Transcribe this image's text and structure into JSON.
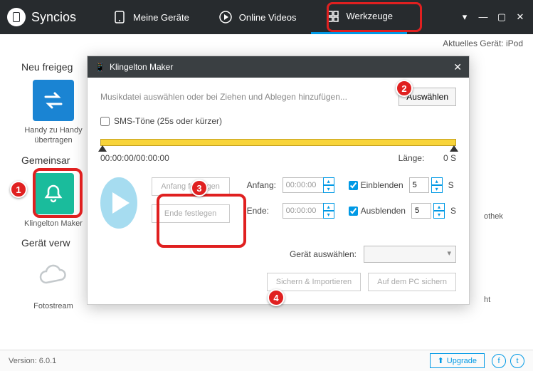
{
  "app": {
    "name": "Syncios"
  },
  "nav": {
    "devices": "Meine Geräte",
    "videos": "Online Videos",
    "tools": "Werkzeuge"
  },
  "status": {
    "device_label": "Aktuelles Gerät: iPod"
  },
  "sections": {
    "s1": "Neu freigeg",
    "s2": "Gemeinsar",
    "s3": "Gerät verw"
  },
  "tiles": {
    "transfer": "Handy zu Handy\nübertragen",
    "ringtone": "Klingelton Maker",
    "fotostream": "Fotostream",
    "library_frag": "othek",
    "save_frag": "ht"
  },
  "modal": {
    "title": "Klingelton Maker",
    "hint": "Musikdatei auswählen oder bei Ziehen und Ablegen hinzufügen...",
    "select": "Auswählen",
    "sms": "SMS-Töne (25s oder kürzer)",
    "time": "00:00:00/00:00:00",
    "length_label": "Länge:",
    "length_val": "0 S",
    "set_start": "Anfang festlegen",
    "set_end": "Ende festlegen",
    "start_label": "Anfang:",
    "end_label": "Ende:",
    "start_val": "00:00:00",
    "end_val": "00:00:00",
    "fadein": "Einblenden",
    "fadeout": "Ausblenden",
    "fade_val": "5",
    "sec": "S",
    "device_sel": "Gerät auswählen:",
    "save_import": "Sichern & Importieren",
    "save_pc": "Auf dem PC sichern"
  },
  "footer": {
    "version": "Version: 6.0.1",
    "upgrade": "Upgrade"
  }
}
